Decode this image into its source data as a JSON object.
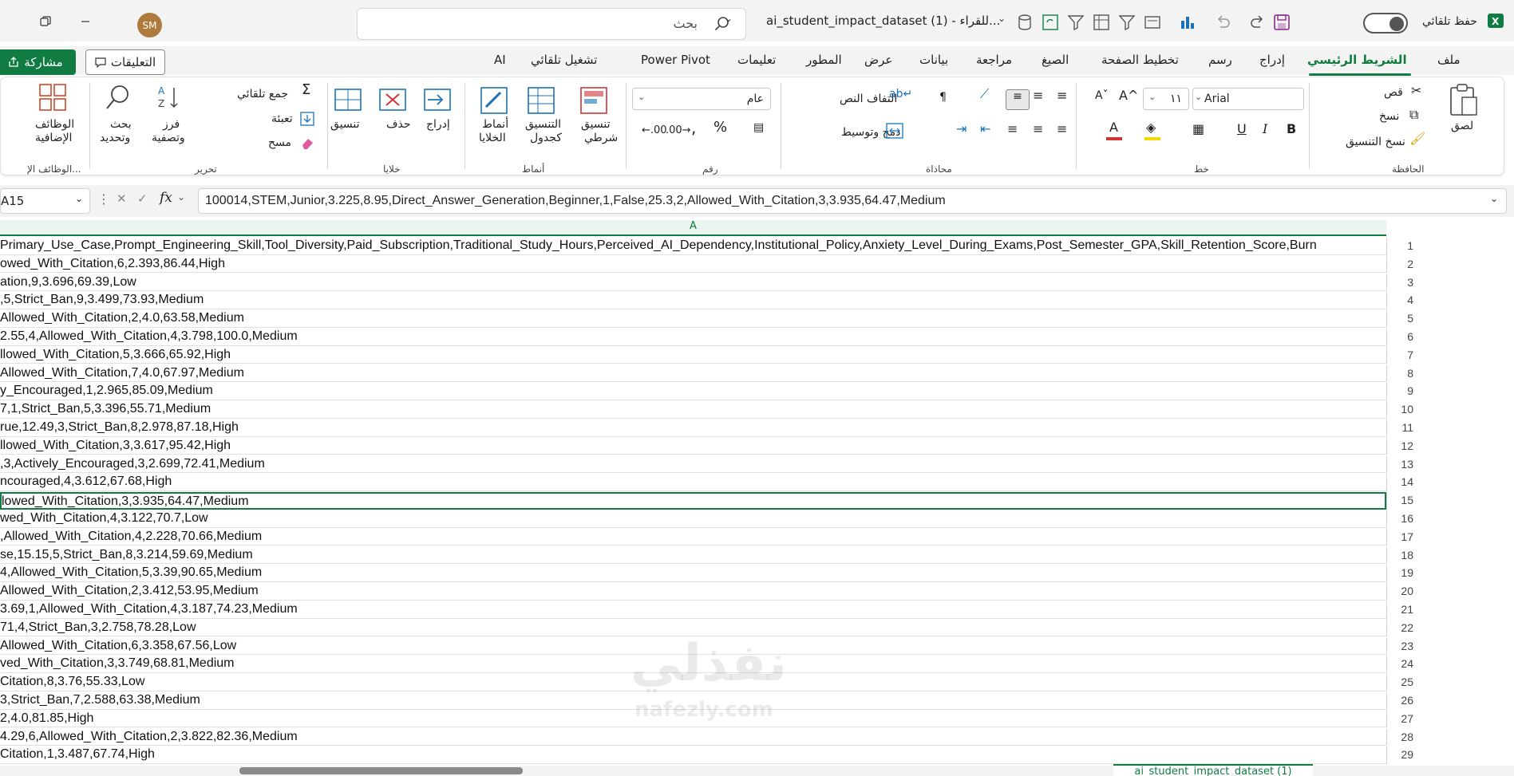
{
  "titlebar": {
    "doc_title": "ai_student_impact_dataset (1)  -  للقراء...",
    "search_placeholder": "بحث",
    "autosave_label": "حفظ تلقائي",
    "avatar_initials": "SM"
  },
  "tabs": {
    "file": "ملف",
    "home": "الشريط الرئيسي",
    "insert": "إدراج",
    "draw": "رسم",
    "page_layout": "تخطيط الصفحة",
    "formulas": "الصيغ",
    "review": "مراجعة",
    "data": "بيانات",
    "view": "عرض",
    "developer": "المطور",
    "help": "تعليمات",
    "power_pivot": "Power Pivot",
    "automate": "تشغيل تلقائي",
    "ai": "AI",
    "comments": "التعليقات",
    "share": "مشاركة"
  },
  "ribbon": {
    "clipboard": {
      "label": "الحافظة",
      "paste": "لصق",
      "cut": "قص",
      "copy": "نسخ",
      "format_painter": "نسخ التنسيق"
    },
    "font": {
      "label": "خط",
      "name": "Arial",
      "size": "١١"
    },
    "alignment": {
      "label": "محاذاة",
      "wrap": "التفاف النص",
      "merge": "دمج وتوسيط"
    },
    "number": {
      "label": "رقم",
      "format": "عام"
    },
    "styles": {
      "label": "أنماط",
      "conditional": "تنسيق\nشرطي",
      "conditional_1": "تنسيق",
      "conditional_2": "شرطي",
      "table_1": "التنسيق",
      "table_2": "كجدول",
      "cell_1": "أنماط",
      "cell_2": "الخلايا"
    },
    "cells": {
      "label": "خلايا",
      "insert": "إدراج",
      "delete": "حذف",
      "format": "تنسيق"
    },
    "editing": {
      "label": "تحرير",
      "autosum": "جمع تلقائي",
      "fill": "تعبئة",
      "clear": "مسح",
      "sort_1": "فرز",
      "sort_2": "وتصفية",
      "find_1": "بحث",
      "find_2": "وتحديد"
    },
    "addins": {
      "label": "الوظائف الإ...",
      "btn_1": "الوظائف",
      "btn_2": "الإضافية"
    }
  },
  "formula_bar": {
    "name_box": "A15",
    "fx": "fx",
    "formula": "100014,STEM,Junior,3.225,8.95,Direct_Answer_Generation,Beginner,1,False,25.3,2,Allowed_With_Citation,3,3.935,64.47,Medium"
  },
  "grid": {
    "column_header": "A",
    "rows": [
      {
        "n": "1",
        "text": "Primary_Use_Case,Prompt_Engineering_Skill,Tool_Diversity,Paid_Subscription,Traditional_Study_Hours,Perceived_AI_Dependency,Institutional_Policy,Anxiety_Level_During_Exams,Post_Semester_GPA,Skill_Retention_Score,Burn"
      },
      {
        "n": "2",
        "text": "owed_With_Citation,6,2.393,86.44,High"
      },
      {
        "n": "3",
        "text": "ation,9,3.696,69.39,Low"
      },
      {
        "n": "4",
        "text": ",5,Strict_Ban,9,3.499,73.93,Medium"
      },
      {
        "n": "5",
        "text": "Allowed_With_Citation,2,4.0,63.58,Medium"
      },
      {
        "n": "6",
        "text": "2.55,4,Allowed_With_Citation,4,3.798,100.0,Medium"
      },
      {
        "n": "7",
        "text": "llowed_With_Citation,5,3.666,65.92,High"
      },
      {
        "n": "8",
        "text": "Allowed_With_Citation,7,4.0,67.97,Medium"
      },
      {
        "n": "9",
        "text": "y_Encouraged,1,2.965,85.09,Medium"
      },
      {
        "n": "10",
        "text": "7,1,Strict_Ban,5,3.396,55.71,Medium"
      },
      {
        "n": "11",
        "text": "rue,12.49,3,Strict_Ban,8,2.978,87.18,High"
      },
      {
        "n": "12",
        "text": "llowed_With_Citation,3,3.617,95.42,High"
      },
      {
        "n": "13",
        "text": ",3,Actively_Encouraged,3,2.699,72.41,Medium"
      },
      {
        "n": "14",
        "text": "ncouraged,4,3.612,67.68,High"
      },
      {
        "n": "15",
        "text": "lowed_With_Citation,3,3.935,64.47,Medium"
      },
      {
        "n": "16",
        "text": "wed_With_Citation,4,3.122,70.7,Low"
      },
      {
        "n": "17",
        "text": ",Allowed_With_Citation,4,2.228,70.66,Medium"
      },
      {
        "n": "18",
        "text": "se,15.15,5,Strict_Ban,8,3.214,59.69,Medium"
      },
      {
        "n": "19",
        "text": "4,Allowed_With_Citation,5,3.39,90.65,Medium"
      },
      {
        "n": "20",
        "text": "Allowed_With_Citation,2,3.412,53.95,Medium"
      },
      {
        "n": "21",
        "text": "3.69,1,Allowed_With_Citation,4,3.187,74.23,Medium"
      },
      {
        "n": "22",
        "text": "71,4,Strict_Ban,3,2.758,78.28,Low"
      },
      {
        "n": "23",
        "text": "Allowed_With_Citation,6,3.358,67.56,Low"
      },
      {
        "n": "24",
        "text": "ved_With_Citation,3,3.749,68.81,Medium"
      },
      {
        "n": "25",
        "text": "Citation,8,3.76,55.33,Low"
      },
      {
        "n": "26",
        "text": "3,Strict_Ban,7,2.588,63.38,Medium"
      },
      {
        "n": "27",
        "text": "2,4.0,81.85,High"
      },
      {
        "n": "28",
        "text": "4.29,6,Allowed_With_Citation,2,3.822,82.36,Medium"
      },
      {
        "n": "29",
        "text": "Citation,1,3.487,67.74,High"
      }
    ],
    "selected_row": "15"
  },
  "watermark": {
    "arabic": "نفذلي",
    "latin": "nafezly.com"
  },
  "sheet_tab": "ai_student_impact_dataset (1)",
  "colors": {
    "accent": "#107c41",
    "selection": "#107c41"
  }
}
